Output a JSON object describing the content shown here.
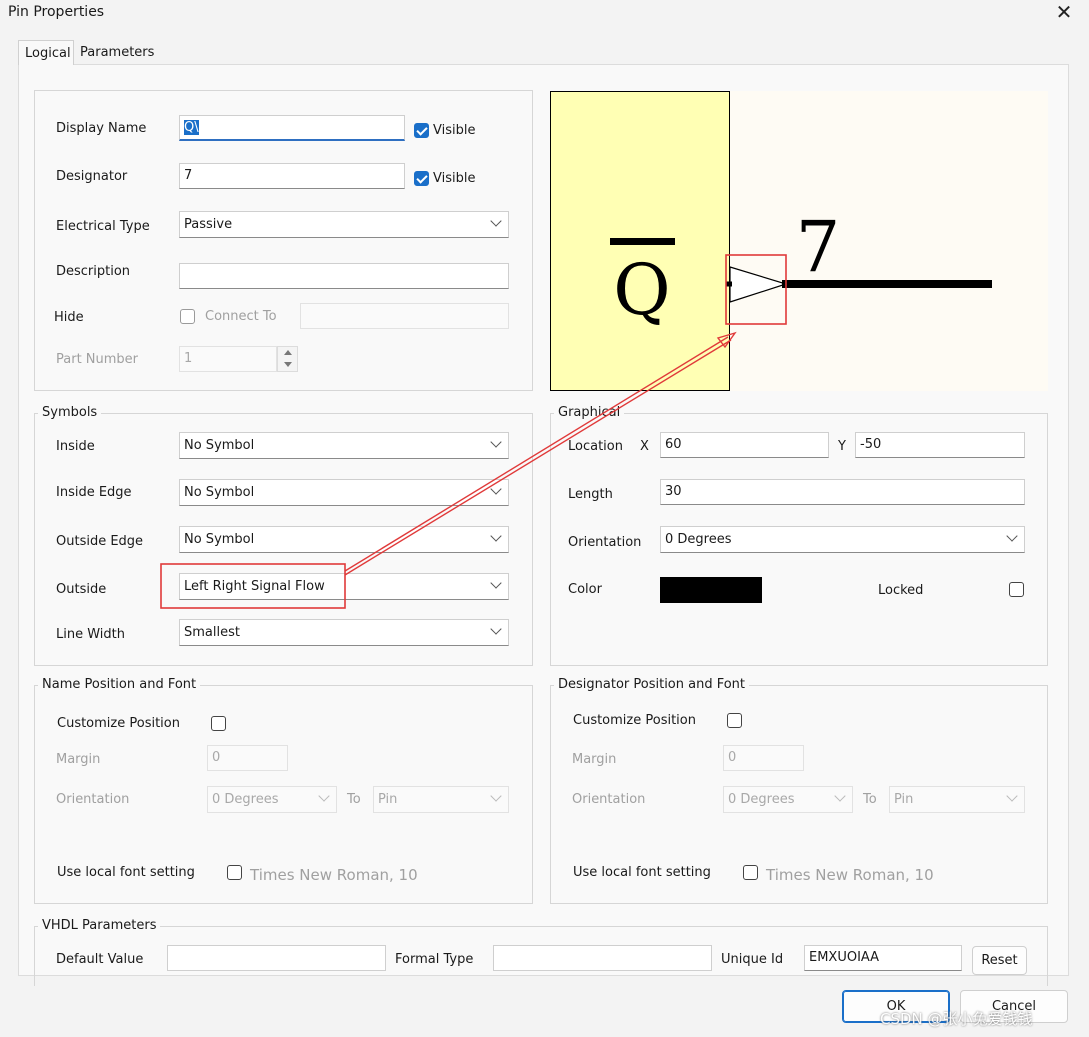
{
  "window": {
    "title": "Pin Properties"
  },
  "tabs": [
    {
      "label": "Logical",
      "active": true
    },
    {
      "label": "Parameters",
      "active": false
    }
  ],
  "logical": {
    "display_name": {
      "label": "Display Name",
      "value": "Q\\",
      "visible_label": "Visible",
      "visible": true
    },
    "designator": {
      "label": "Designator",
      "value": "7",
      "visible_label": "Visible",
      "visible": true
    },
    "electrical_type": {
      "label": "Electrical Type",
      "value": "Passive"
    },
    "description": {
      "label": "Description",
      "value": ""
    },
    "hide": {
      "label": "Hide",
      "connect_to_label": "Connect To",
      "checked": false,
      "connect_to_value": ""
    },
    "part_number": {
      "label": "Part Number",
      "value": "1"
    }
  },
  "preview": {
    "pin_name": "Q",
    "designator": "7",
    "body_color": "#ffffb4",
    "pin_color": "#000000",
    "highlight_color": "#e03a3a"
  },
  "symbols": {
    "title": "Symbols",
    "inside": {
      "label": "Inside",
      "value": "No Symbol"
    },
    "inside_edge": {
      "label": "Inside Edge",
      "value": "No Symbol"
    },
    "outside_edge": {
      "label": "Outside Edge",
      "value": "No Symbol"
    },
    "outside": {
      "label": "Outside",
      "value": "Left Right Signal Flow"
    },
    "line_width": {
      "label": "Line Width",
      "value": "Smallest"
    }
  },
  "graphical": {
    "title": "Graphical",
    "location_label": "Location",
    "x_label": "X",
    "x_value": "60",
    "y_label": "Y",
    "y_value": "-50",
    "length": {
      "label": "Length",
      "value": "30"
    },
    "orientation": {
      "label": "Orientation",
      "value": "0 Degrees"
    },
    "color": {
      "label": "Color",
      "value": "#000000"
    },
    "locked": {
      "label": "Locked",
      "checked": false
    }
  },
  "name_font": {
    "title": "Name Position and Font",
    "customize_label": "Customize Position",
    "margin_label": "Margin",
    "margin_value": "0",
    "orientation_label": "Orientation",
    "orientation_value": "0 Degrees",
    "to_label": "To",
    "to_value": "Pin",
    "font_label": "Use local font setting",
    "font_value": "Times New Roman, 10"
  },
  "designator_font": {
    "title": "Designator Position and Font",
    "customize_label": "Customize Position",
    "margin_label": "Margin",
    "margin_value": "0",
    "orientation_label": "Orientation",
    "orientation_value": "0 Degrees",
    "to_label": "To",
    "to_value": "Pin",
    "font_label": "Use local font setting",
    "font_value": "Times New Roman, 10"
  },
  "vhdl": {
    "title": "VHDL Parameters",
    "default_value_label": "Default Value",
    "default_value": "",
    "formal_type_label": "Formal Type",
    "formal_type": "",
    "unique_id_label": "Unique Id",
    "unique_id": "EMXUOIAA",
    "reset_label": "Reset"
  },
  "footer": {
    "ok_label": "OK",
    "cancel_label": "Cancel"
  },
  "watermark": "CSDN @张小兔爱钱钱"
}
